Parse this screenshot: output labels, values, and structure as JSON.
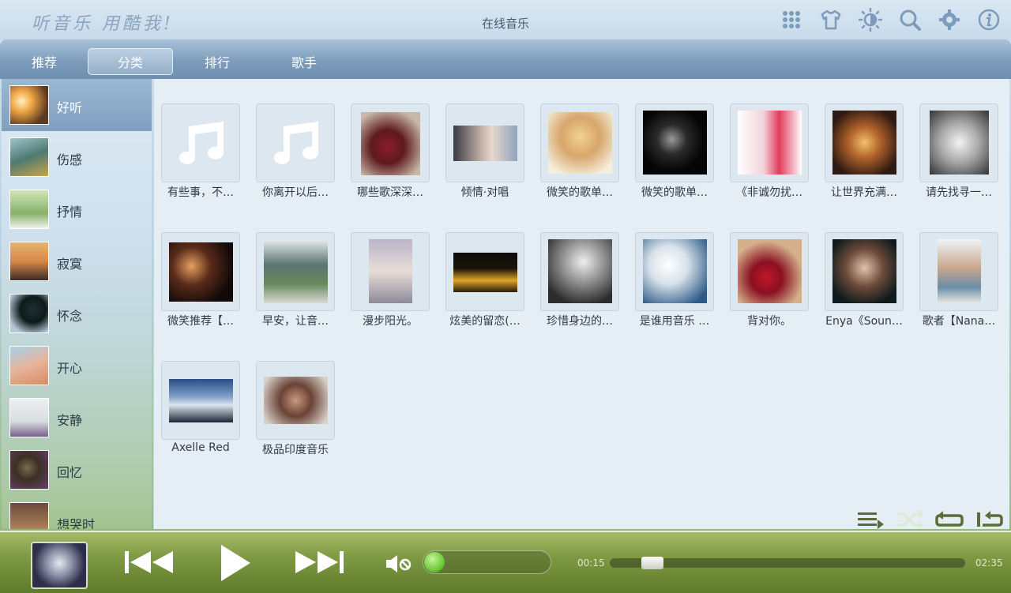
{
  "header": {
    "logo_text": "听音乐 用酷我!",
    "title": "在线音乐",
    "icons": [
      "apps-grid-icon",
      "skin-shirt-icon",
      "brightness-icon",
      "search-icon",
      "settings-gear-icon",
      "info-icon"
    ]
  },
  "tabs": [
    {
      "label": "推荐",
      "active": false
    },
    {
      "label": "分类",
      "active": true
    },
    {
      "label": "排行",
      "active": false
    },
    {
      "label": "歌手",
      "active": false
    }
  ],
  "sidebar": {
    "items": [
      {
        "label": "好听",
        "active": true
      },
      {
        "label": "伤感",
        "active": false
      },
      {
        "label": "抒情",
        "active": false
      },
      {
        "label": "寂寞",
        "active": false
      },
      {
        "label": "怀念",
        "active": false
      },
      {
        "label": "开心",
        "active": false
      },
      {
        "label": "安静",
        "active": false
      },
      {
        "label": "回忆",
        "active": false
      },
      {
        "label": "想哭时",
        "active": false
      }
    ]
  },
  "albums": [
    {
      "title": "有些事，不…",
      "art": "music-note"
    },
    {
      "title": "你离开以后…",
      "art": "music-note"
    },
    {
      "title": "哪些歌深深…",
      "art": "photo"
    },
    {
      "title": "倾情·对唱",
      "art": "photo"
    },
    {
      "title": "微笑的歌单…",
      "art": "photo"
    },
    {
      "title": "微笑的歌单…",
      "art": "photo"
    },
    {
      "title": "《非诚勿扰…",
      "art": "photo"
    },
    {
      "title": "让世界充满…",
      "art": "photo"
    },
    {
      "title": "请先找寻一…",
      "art": "photo"
    },
    {
      "title": "微笑推荐【…",
      "art": "photo"
    },
    {
      "title": "早安，让音…",
      "art": "photo"
    },
    {
      "title": "漫步阳光。",
      "art": "photo"
    },
    {
      "title": "炫美的留恋(…",
      "art": "photo"
    },
    {
      "title": "珍惜身边的…",
      "art": "photo"
    },
    {
      "title": "是谁用音乐 …",
      "art": "photo"
    },
    {
      "title": "背对你。",
      "art": "photo"
    },
    {
      "title": "Enya《Soun…",
      "art": "photo"
    },
    {
      "title": "歌者【Nana…",
      "art": "photo"
    },
    {
      "title": "Axelle Red",
      "art": "photo"
    },
    {
      "title": "极品印度音乐",
      "art": "photo"
    }
  ],
  "play_modes": [
    "playlist-order-icon",
    "shuffle-icon",
    "repeat-all-icon",
    "repeat-one-icon"
  ],
  "player": {
    "elapsed": "00:15",
    "duration": "02:35",
    "volume_level": 0,
    "progress_fraction": 0.1,
    "muted": true
  }
}
